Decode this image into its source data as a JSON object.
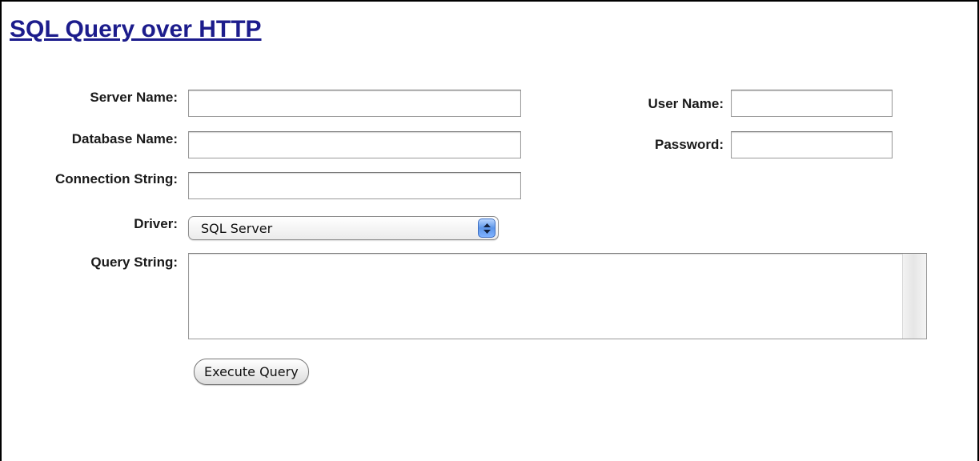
{
  "page": {
    "title": "SQL Query over HTTP"
  },
  "form": {
    "server_name": {
      "label": "Server Name:",
      "value": ""
    },
    "database_name": {
      "label": "Database Name:",
      "value": ""
    },
    "connection_string": {
      "label": "Connection String:",
      "value": ""
    },
    "driver": {
      "label": "Driver:",
      "selected": "SQL Server"
    },
    "query_string": {
      "label": "Query String:",
      "value": ""
    },
    "user_name": {
      "label": "User Name:",
      "value": ""
    },
    "password": {
      "label": "Password:",
      "value": ""
    },
    "execute_button": {
      "label": "Execute Query"
    }
  },
  "colors": {
    "title_link": "#1c1c8c",
    "label_text": "#1a1a1a",
    "select_arrow_accent": "#5c95e8"
  },
  "icons": {
    "driver_select": "up-down-arrows-icon"
  }
}
